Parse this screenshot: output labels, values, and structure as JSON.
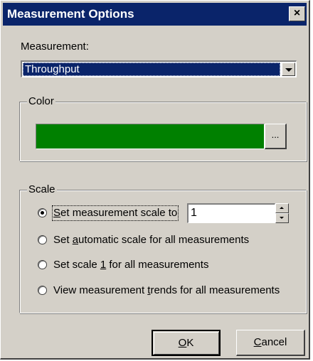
{
  "dialog": {
    "title": "Measurement Options",
    "close_glyph": "×"
  },
  "measurement": {
    "label": "Measurement:",
    "selected": "Throughput"
  },
  "color_group": {
    "title": "Color",
    "swatch_color": "#008000",
    "picker_label": "..."
  },
  "scale_group": {
    "title": "Scale",
    "scale_value": "1",
    "options": [
      {
        "pre": "",
        "ul": "S",
        "post": "et measurement scale to",
        "selected": true
      },
      {
        "pre": "Set ",
        "ul": "a",
        "post": "utomatic scale for all measurements",
        "selected": false
      },
      {
        "pre": "Set scale ",
        "ul": "1",
        "post": " for all measurements",
        "selected": false
      },
      {
        "pre": "View measurement ",
        "ul": "t",
        "post": "rends for all measurements",
        "selected": false
      }
    ]
  },
  "buttons": {
    "ok": {
      "ul": "O",
      "post": "K"
    },
    "cancel": {
      "ul": "C",
      "post": "ancel"
    }
  },
  "icons": {
    "close": "close-icon",
    "dropdown": "chevron-down-icon",
    "spin_up": "spin-up-icon",
    "spin_down": "spin-down-icon",
    "radio_selected": "radio-selected-icon"
  }
}
